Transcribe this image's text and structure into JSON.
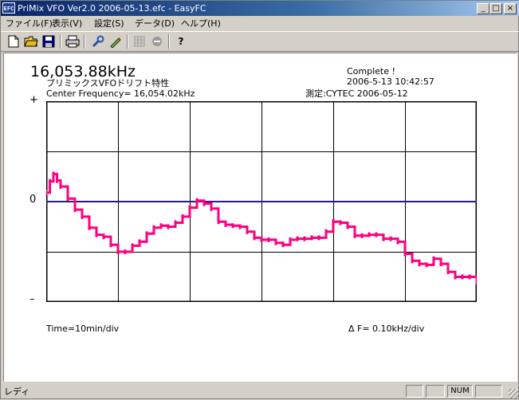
{
  "window": {
    "icon_text": "EFC",
    "title": "PriMix VFO Ver2.0 2006-05-13.efc - EasyFC",
    "minimize": "_",
    "maximize": "□",
    "close": "×"
  },
  "menu": [
    {
      "label": "ファイル(F)"
    },
    {
      "label": "表示(V)"
    },
    {
      "label": "設定(S)"
    },
    {
      "label": "データ(D)"
    },
    {
      "label": "ヘルプ(H)"
    }
  ],
  "toolbar": {
    "icons": [
      "new-file-icon",
      "open-folder-icon",
      "save-disk-icon",
      "print-icon",
      "settings-wrench-icon",
      "pen-icon",
      "grid-icon",
      "stop-icon",
      "help-icon"
    ]
  },
  "display": {
    "frequency": "16,053.88kHz",
    "subtitle": "プリミックスVFOドリフト特性",
    "center_frequency": "Center Frequency= 16,054.02kHz",
    "status": "Complete !",
    "timestamp": "2006-5-13  10:42:57",
    "measurement": "測定:CYTEC  2006-05-12",
    "y_top": "+",
    "y_mid": "0",
    "y_bottom": "–",
    "time_div": "Time=10min/div",
    "freq_div": "Δ F=    0.10kHz/div"
  },
  "chart_data": {
    "type": "line",
    "title": "",
    "xlabel": "Time=10min/div",
    "ylabel": "Δ F= 0.10kHz/div",
    "x_unit": "min",
    "y_unit": "kHz",
    "xlim": [
      0,
      60
    ],
    "ylim": [
      -0.2,
      0.2
    ],
    "x_gridlines": 6,
    "y_gridlines": 4,
    "grid": true,
    "baseline": 0,
    "baseline_color": "#2a1a8a",
    "grid_color": "#000000",
    "series": [
      {
        "color": "#ff0080",
        "x": [
          0,
          0.5,
          1,
          1.5,
          2,
          3,
          4,
          5,
          6,
          7,
          8,
          9,
          10,
          11,
          12,
          13,
          14,
          15,
          16,
          17,
          18,
          19,
          20,
          21,
          22,
          23,
          24,
          25,
          26,
          27,
          28,
          29,
          30,
          31,
          32,
          33,
          34,
          35,
          36,
          37,
          38,
          39,
          40,
          41,
          42,
          43,
          44,
          45,
          46,
          47,
          48,
          49,
          50,
          51,
          52,
          53,
          54,
          55,
          56,
          57,
          58,
          59,
          60
        ],
        "y": [
          0.018,
          0.04,
          0.055,
          0.042,
          0.03,
          0.006,
          -0.016,
          -0.03,
          -0.052,
          -0.066,
          -0.07,
          -0.086,
          -0.1,
          -0.1,
          -0.088,
          -0.08,
          -0.064,
          -0.052,
          -0.048,
          -0.05,
          -0.042,
          -0.03,
          -0.012,
          0.002,
          -0.004,
          -0.014,
          -0.04,
          -0.046,
          -0.048,
          -0.05,
          -0.06,
          -0.072,
          -0.076,
          -0.076,
          -0.082,
          -0.086,
          -0.076,
          -0.074,
          -0.074,
          -0.072,
          -0.072,
          -0.06,
          -0.04,
          -0.042,
          -0.05,
          -0.068,
          -0.068,
          -0.066,
          -0.066,
          -0.074,
          -0.074,
          -0.08,
          -0.104,
          -0.118,
          -0.124,
          -0.126,
          -0.114,
          -0.124,
          -0.14,
          -0.15,
          -0.15,
          -0.15,
          -0.16
        ]
      }
    ]
  },
  "statusbar": {
    "text": "レディ",
    "num": "NUM"
  }
}
